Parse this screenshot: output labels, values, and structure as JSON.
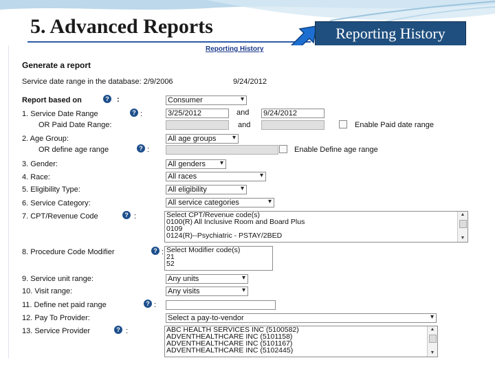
{
  "slide": {
    "title": "5. Advanced Reports",
    "callout": "Reporting History"
  },
  "form": {
    "top_link": "Reporting History",
    "heading": "Generate a report",
    "date_range_label": "Service date range in the database: 2/9/2006",
    "date_range_end": "9/24/2012",
    "report_based_on_label": "Report based on",
    "report_based_on_value": "Consumer",
    "colon": ":",
    "and": "and",
    "rows": {
      "r1_label": "1.  Service Date Range",
      "r1_from": "3/25/2012",
      "r1_to": "9/24/2012",
      "r1b_label": "OR Paid Date Range:",
      "r1b_check_label": "Enable Paid date range",
      "r2_label": "2.  Age Group:",
      "r2_value": "All age groups",
      "r2b_label": "OR define age range",
      "r2b_check_label": "Enable Define age range",
      "r3_label": "3.  Gender:",
      "r3_value": "All genders",
      "r4_label": "4.  Race:",
      "r4_value": "All races",
      "r5_label": "5.  Eligibility Type:",
      "r5_value": "All eligibility",
      "r6_label": "6.  Service Category:",
      "r6_value": "All service categories",
      "r7_label": "7.  CPT/Revenue Code",
      "r7_items": [
        "Select CPT/Revenue code(s)",
        "0100(R)  All Inclusive Room and Board Plus",
        "0109",
        "0124(R)--Psychiatric - PSTAY/2BED"
      ],
      "r8_label": "8.  Procedure Code Modifier",
      "r8_items": [
        "Select Modifier code(s)",
        "21",
        "52"
      ],
      "r9_label": "9.  Service unit range:",
      "r9_value": "Any units",
      "r10_label": "10.  Visit range:",
      "r10_value": "Any visits",
      "r11_label": "11.  Define net paid range",
      "r12_label": "12.  Pay To Provider:",
      "r12_value": "Select a pay-to-vendor",
      "r13_label": "13.  Service Provider",
      "r13_items": [
        "ABC HEALTH SERVICES INC (5100582)",
        "ADVENTHEALTHCARE INC (5101158)",
        "ADVENTHEALTHCARE INC (5101167)",
        "ADVENTHEALTHCARE INC (5102445)"
      ]
    },
    "help_glyph": "?"
  }
}
